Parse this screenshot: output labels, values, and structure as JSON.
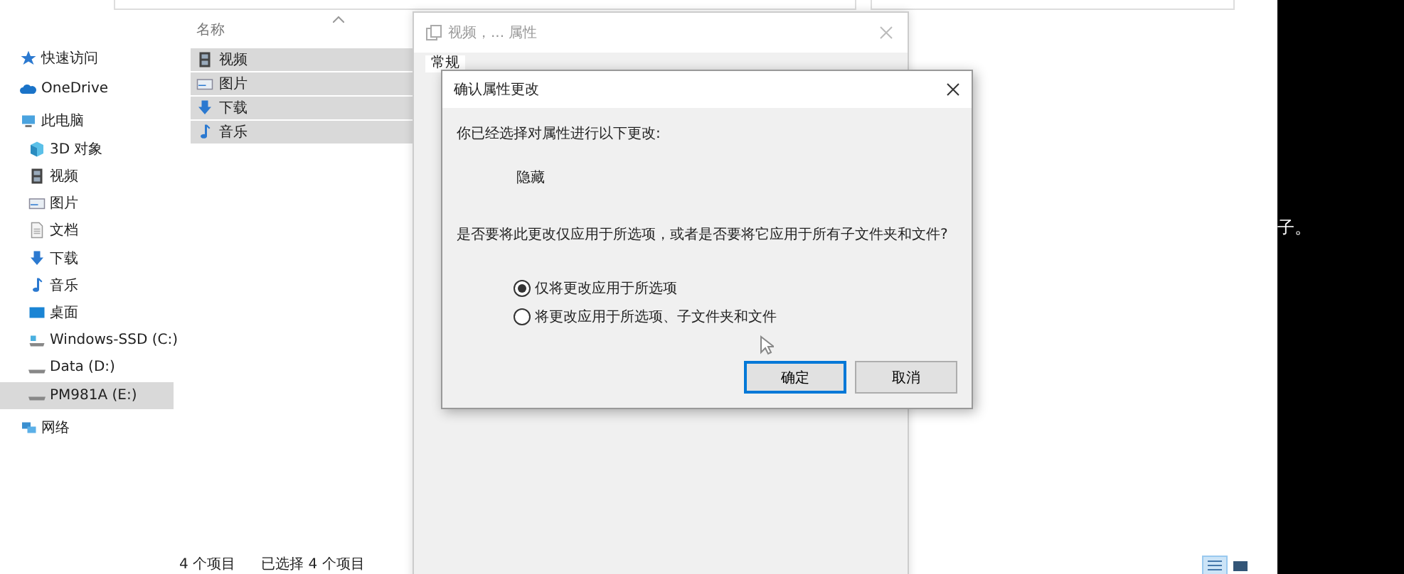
{
  "navigation": [
    {
      "label": "快速访问",
      "kind": "star",
      "selected": false
    },
    {
      "label": "OneDrive",
      "kind": "cloud",
      "selected": false
    },
    {
      "label": "此电脑",
      "kind": "computer",
      "selected": false,
      "children": [
        {
          "label": "3D 对象",
          "kind": "cube",
          "selected": false
        },
        {
          "label": "视频",
          "kind": "film",
          "selected": false
        },
        {
          "label": "图片",
          "kind": "image",
          "selected": false
        },
        {
          "label": "文档",
          "kind": "document",
          "selected": false
        },
        {
          "label": "下载",
          "kind": "download",
          "selected": false
        },
        {
          "label": "音乐",
          "kind": "music",
          "selected": false
        },
        {
          "label": "桌面",
          "kind": "desktop",
          "selected": false
        },
        {
          "label": "Windows-SSD (C:)",
          "kind": "systemdrive",
          "selected": false
        },
        {
          "label": "Data (D:)",
          "kind": "drive",
          "selected": false
        },
        {
          "label": "PM981A (E:)",
          "kind": "drive",
          "selected": true
        }
      ]
    },
    {
      "label": "网络",
      "kind": "network",
      "selected": false
    }
  ],
  "file_list": {
    "column_header": "名称",
    "rows": [
      {
        "name": "视频",
        "kind": "film",
        "selected": true
      },
      {
        "name": "图片",
        "kind": "image",
        "selected": true
      },
      {
        "name": "下载",
        "kind": "download",
        "selected": true
      },
      {
        "name": "音乐",
        "kind": "music",
        "selected": true
      }
    ]
  },
  "status_bar": {
    "item_count": "4 个项目",
    "selection": "已选择 4 个项目"
  },
  "properties_window": {
    "title": "视频，... 属性",
    "tabs": [
      {
        "label": "常规",
        "selected": true
      }
    ]
  },
  "confirm_dialog": {
    "title": "确认属性更改",
    "intro": "你已经选择对属性进行以下更改:",
    "change": "隐藏",
    "question": "是否要将此更改仅应用于所选项，或者是否要将它应用于所有子文件夹和文件?",
    "options": [
      {
        "label": "仅将更改应用于所选项",
        "selected": true
      },
      {
        "label": "将更改应用于所选项、子文件夹和文件",
        "selected": false
      }
    ],
    "buttons": [
      {
        "label": "确定",
        "kind": "default"
      },
      {
        "label": "取消",
        "kind": "normal"
      }
    ]
  },
  "side_caption": "子。"
}
